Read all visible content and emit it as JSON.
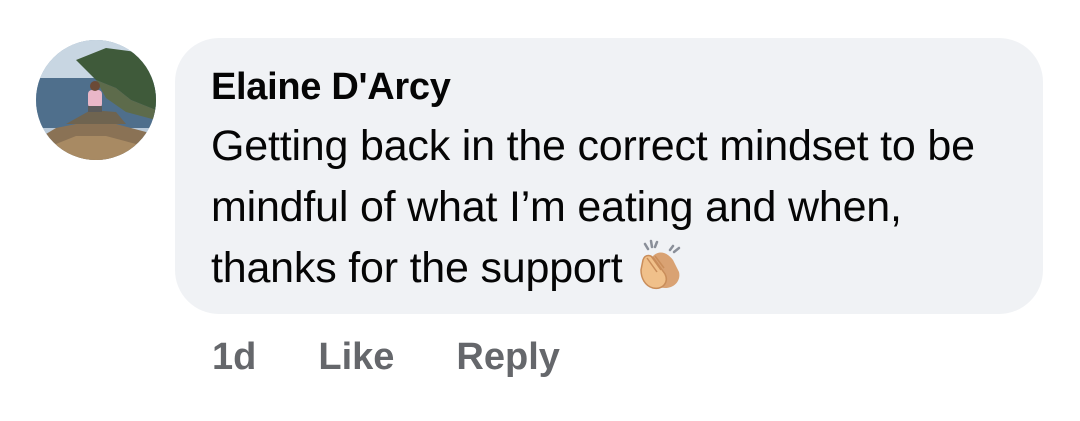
{
  "comment": {
    "author": "Elaine D'Arcy",
    "text": "Getting back in the correct mindset to be mindful of what I’m eating and when, thanks for the support",
    "emoji_icon": "clapping-hands-icon"
  },
  "actions": {
    "time": "1d",
    "like_label": "Like",
    "reply_label": "Reply"
  },
  "colors": {
    "bubble_bg": "#f0f2f5",
    "text": "#050505",
    "secondary_text": "#65676b"
  }
}
